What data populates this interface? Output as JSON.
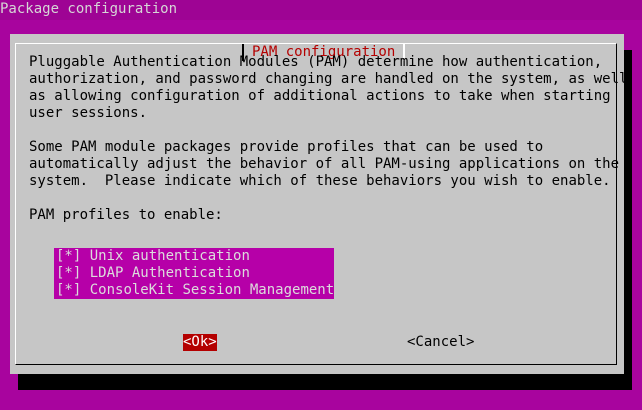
{
  "window": {
    "title": "Package configuration"
  },
  "dialog": {
    "title": "PAM configuration",
    "paragraph1": [
      "Pluggable Authentication Modules (PAM) determine how authentication,",
      "authorization, and password changing are handled on the system, as well",
      "as allowing configuration of additional actions to take when starting",
      "user sessions."
    ],
    "paragraph2": [
      "Some PAM module packages provide profiles that can be used to",
      "automatically adjust the behavior of all PAM-using applications on the",
      "system.  Please indicate which of these behaviors you wish to enable."
    ],
    "prompt": "PAM profiles to enable:",
    "options": [
      {
        "mark": "[*]",
        "label": "Unix authentication"
      },
      {
        "mark": "[*]",
        "label": "LDAP Authentication"
      },
      {
        "mark": "[*]",
        "label": "ConsoleKit Session Management"
      }
    ],
    "buttons": {
      "ok": "<Ok>",
      "cancel": "<Cancel>"
    }
  },
  "colors": {
    "background": "#a8049e",
    "dialog": "#c6c6c6",
    "title_text": "#b40000",
    "selected_button": "#b40000",
    "list_highlight": "#b600a8"
  }
}
